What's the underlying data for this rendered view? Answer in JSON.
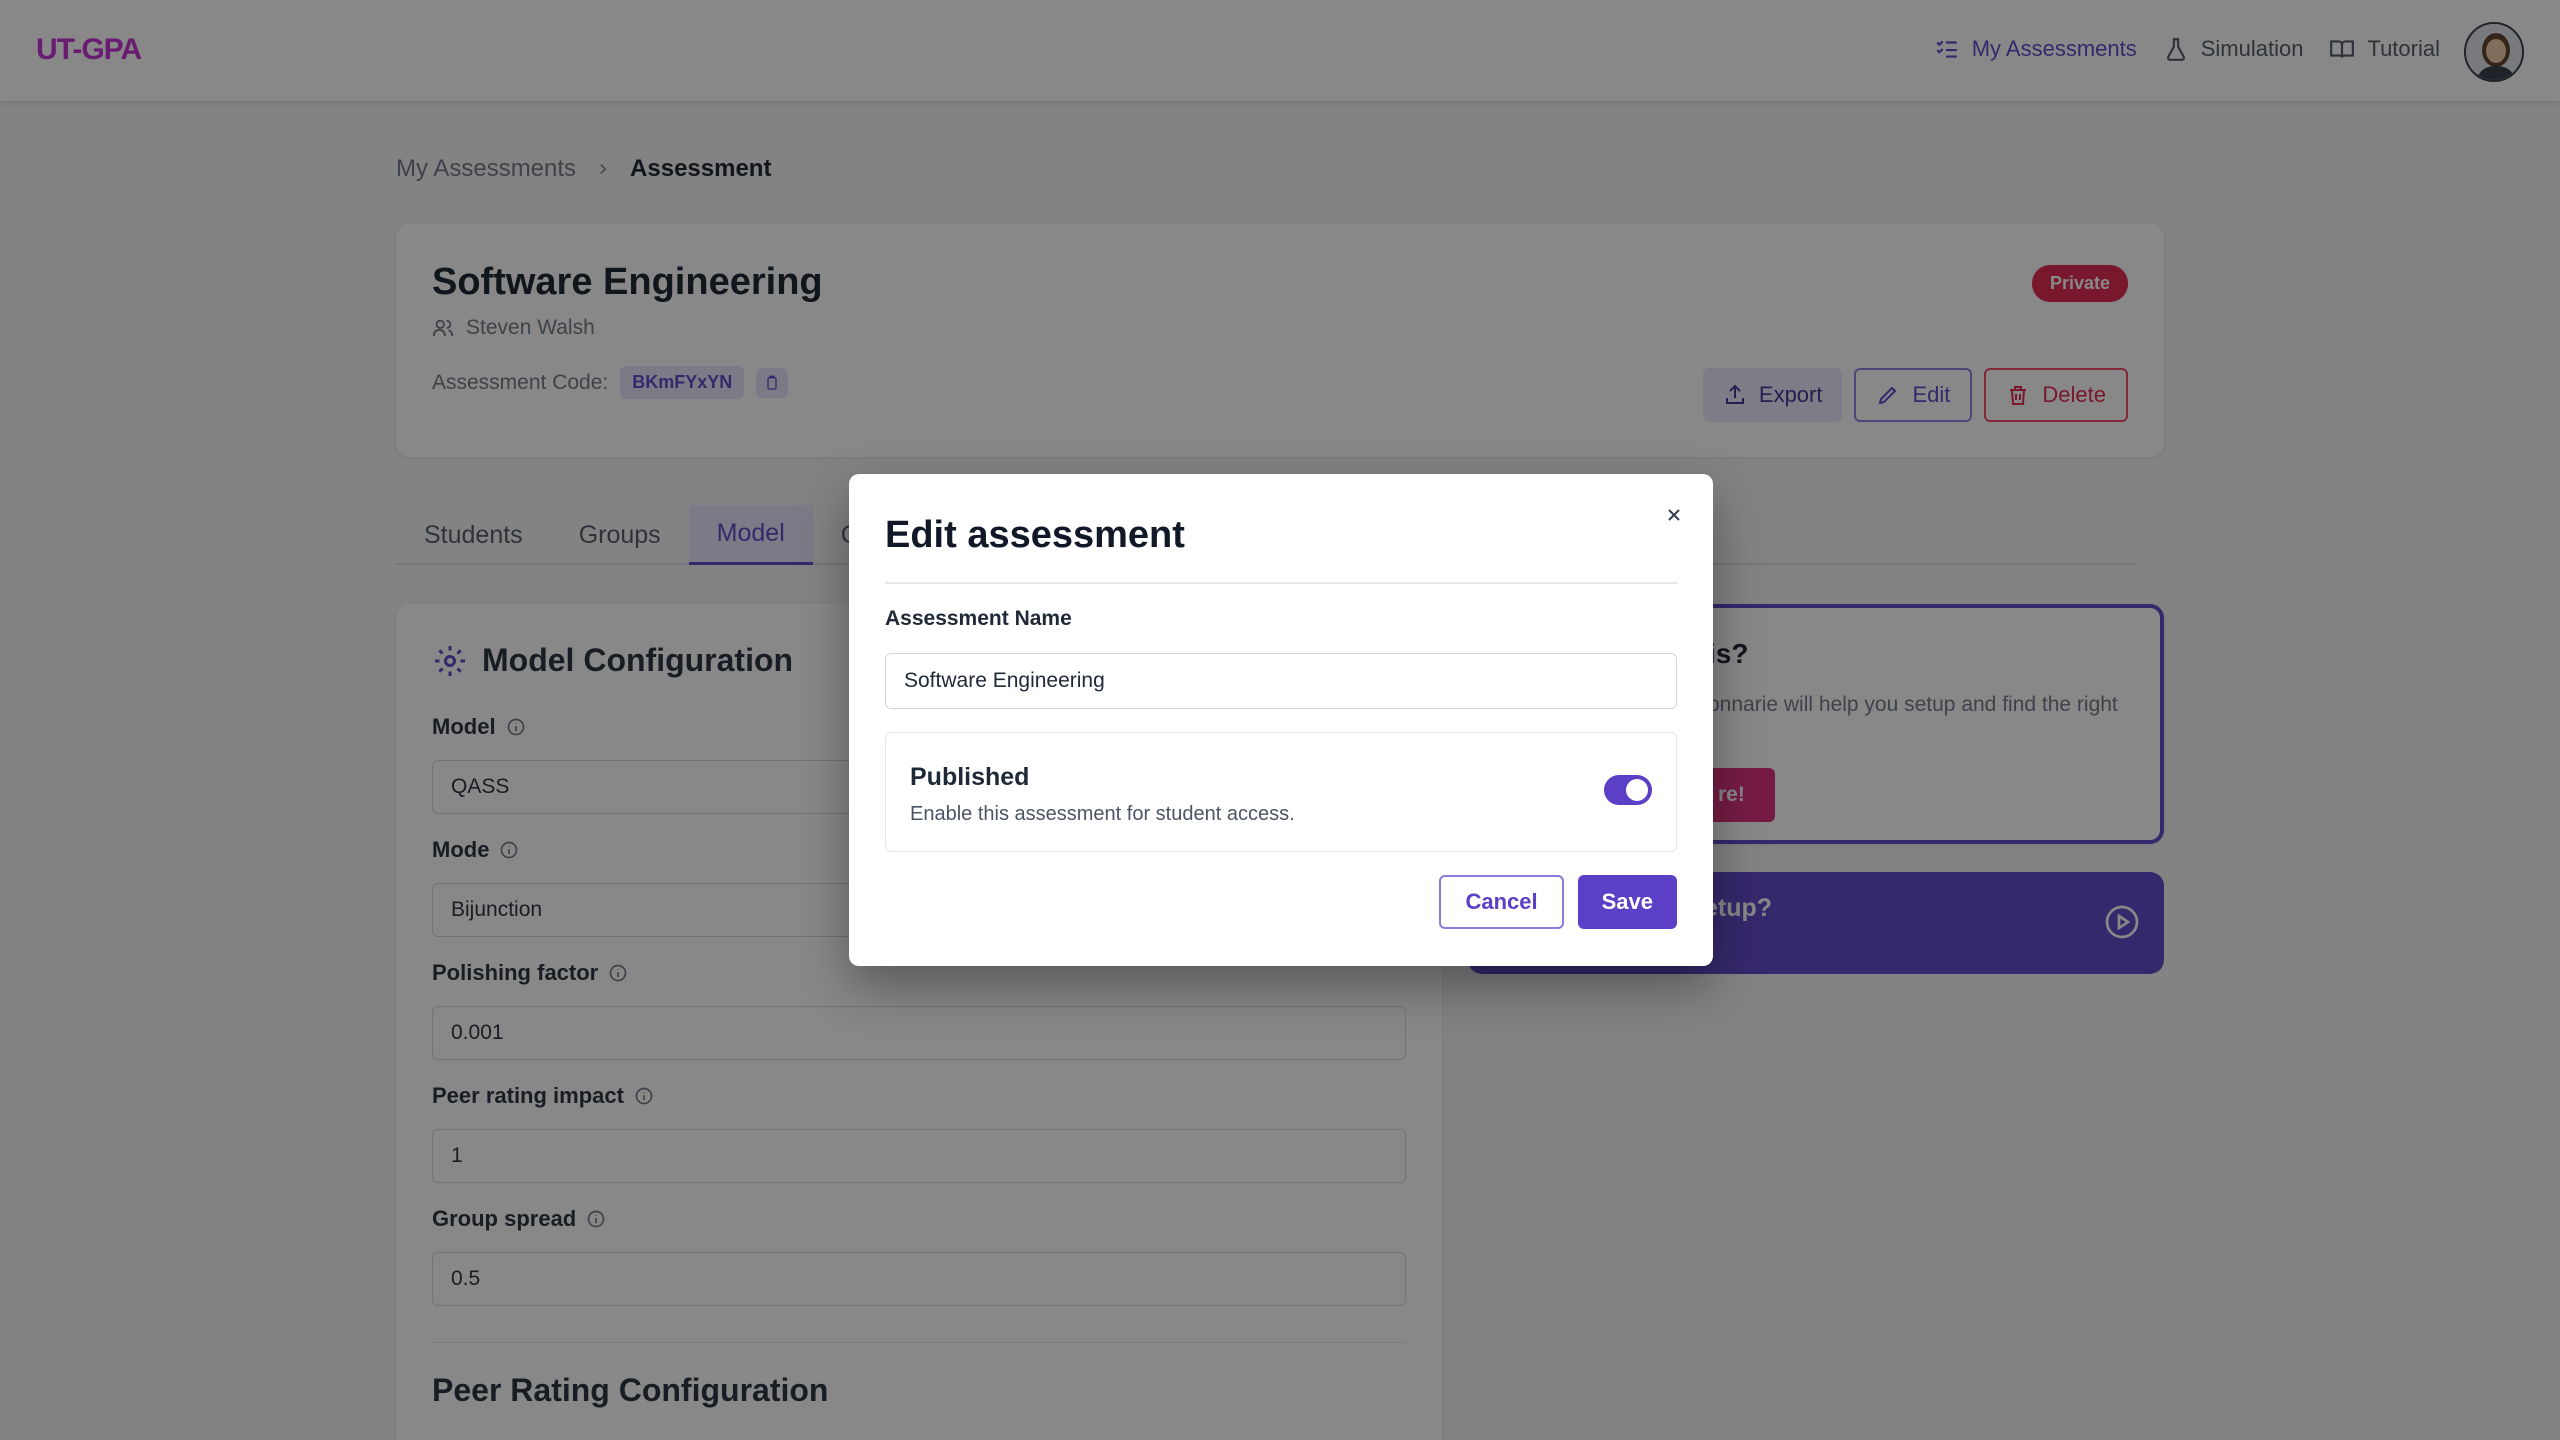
{
  "nav": {
    "logo": "UT-GPA",
    "links": [
      {
        "label": "My Assessments",
        "icon": "list-check-icon",
        "active": true
      },
      {
        "label": "Simulation",
        "icon": "flask-icon",
        "active": false
      },
      {
        "label": "Tutorial",
        "icon": "book-open-icon",
        "active": false
      }
    ],
    "avatar": "user-avatar"
  },
  "breadcrumb": {
    "root": "My Assessments",
    "current": "Assessment"
  },
  "assessment": {
    "title": "Software Engineering",
    "owner": "Steven Walsh",
    "code_label": "Assessment Code:",
    "code": "BKmFYxYN",
    "visibility": "Private",
    "actions": {
      "export": "Export",
      "edit": "Edit",
      "delete": "Delete"
    }
  },
  "tabs": [
    {
      "label": "Students",
      "active": false
    },
    {
      "label": "Groups",
      "active": false
    },
    {
      "label": "Model",
      "active": true
    },
    {
      "label": "Co",
      "active": false
    }
  ],
  "model_config": {
    "title": "Model Configuration",
    "fields": [
      {
        "label": "Model",
        "value": "QASS"
      },
      {
        "label": "Mode",
        "value": "Bijunction"
      },
      {
        "label": "Polishing factor",
        "value": "0.001"
      },
      {
        "label": "Peer rating impact",
        "value": "1"
      },
      {
        "label": "Group spread",
        "value": "0.5"
      }
    ],
    "peer_title": "Peer Rating Configuration"
  },
  "side": {
    "title_fragment": "is?",
    "text_fragment": "onnarie will help you setup and find the right",
    "button_fragment": "re!",
    "setup_fragment": "etup?"
  },
  "modal": {
    "title": "Edit assessment",
    "name_label": "Assessment Name",
    "name_value": "Software Engineering",
    "published_title": "Published",
    "published_desc": "Enable this assessment for student access.",
    "published_on": true,
    "cancel": "Cancel",
    "save": "Save"
  },
  "colors": {
    "accent": "#5b3fc7",
    "brand": "#c026d3",
    "danger": "#e11d48"
  }
}
